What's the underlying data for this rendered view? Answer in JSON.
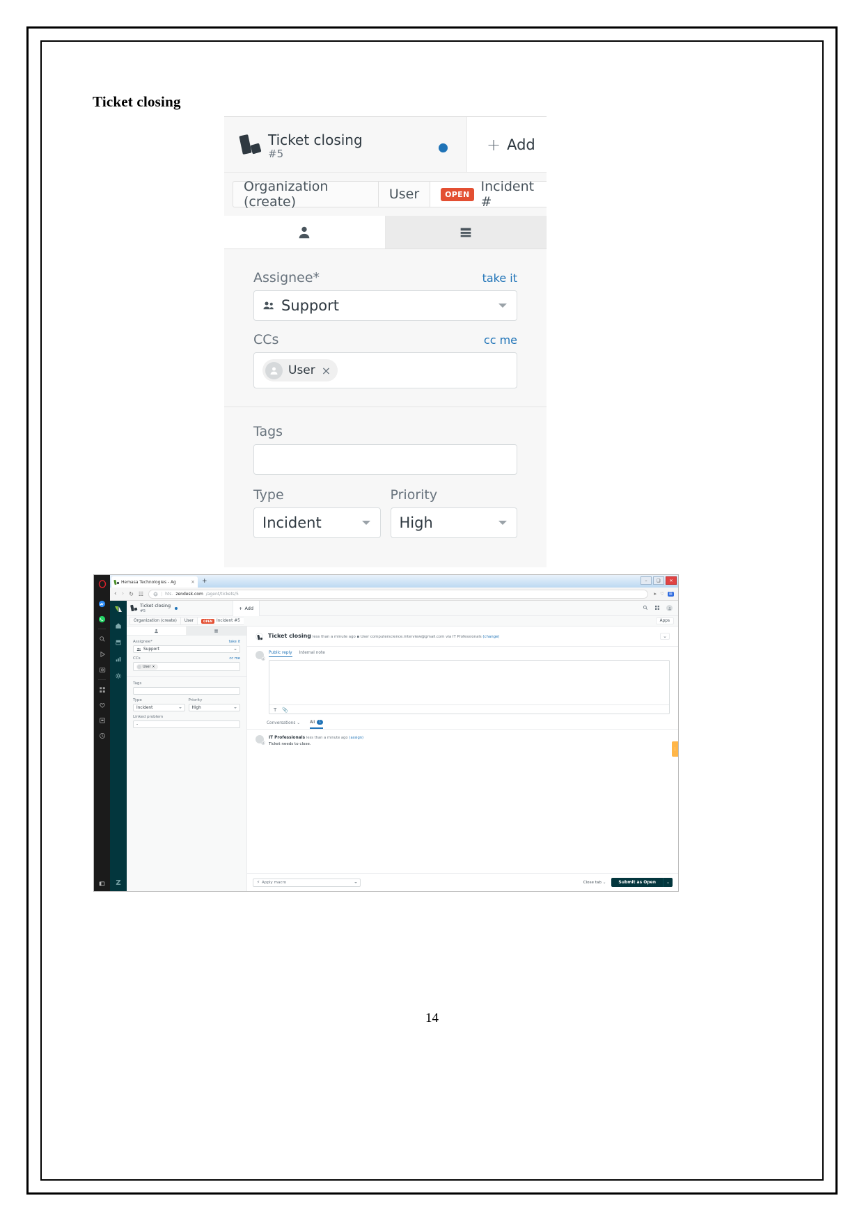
{
  "document": {
    "heading": "Ticket closing",
    "page_number": "14"
  },
  "zoom_panel": {
    "ticket_title": "Ticket closing",
    "ticket_number": "#5",
    "add_label": "Add",
    "add_plus": "+",
    "breadcrumbs": [
      {
        "label": "Organization (create)",
        "badge": ""
      },
      {
        "label": "User",
        "badge": ""
      },
      {
        "label": "Incident #",
        "badge": "OPEN"
      }
    ],
    "tabs": [
      {
        "icon": "person-icon",
        "selected": false
      },
      {
        "icon": "list-icon",
        "selected": true
      }
    ],
    "fields": {
      "assignee_label": "Assignee*",
      "assignee_action": "take it",
      "assignee_value": "Support",
      "ccs_label": "CCs",
      "ccs_action": "cc me",
      "ccs_chip": "User",
      "ccs_chip_remove": "×",
      "tags_label": "Tags",
      "tags_value": "",
      "type_label": "Type",
      "type_value": "Incident",
      "priority_label": "Priority",
      "priority_value": "High"
    }
  },
  "browser": {
    "tab_title": "Hemasa Technologies - Ag",
    "tab_close": "×",
    "new_tab": "+",
    "window_buttons": {
      "minimize": "–",
      "maximize": "❑",
      "close": "✕"
    },
    "nav": {
      "back": "‹",
      "forward": "›",
      "reload": "↻",
      "grid": "☷"
    },
    "omnibox": {
      "security_icon": "globe-icon",
      "url_prefix": "hts.",
      "url_domain": "zendesk.com",
      "url_path": "/agent/tickets/5"
    },
    "omni_right": {
      "share": "➤",
      "heart": "♡",
      "profile": "☰"
    },
    "opera_sidebar": [
      "opera-logo-icon",
      "messenger-icon",
      "whatsapp-icon",
      "search-icon",
      "player-icon",
      "snapshot-icon",
      "apps-grid-icon",
      "heart-icon",
      "notes-icon",
      "history-icon"
    ],
    "opera_bottom": "panel-toggle-icon"
  },
  "zendesk": {
    "nav_icons": [
      "zendesk-logo-icon",
      "home-icon",
      "views-icon",
      "reporting-icon",
      "admin-icon"
    ],
    "nav_footer": "Z",
    "header": {
      "ticket_title": "Ticket closing",
      "ticket_number": "#5",
      "add_label": "Add",
      "add_plus": "+",
      "search_icon": "search-icon",
      "apps_icon": "apps-grid-icon",
      "avatar_icon": "user-avatar-icon"
    },
    "breadcrumbs": [
      {
        "label": "Organization (create)",
        "badge": ""
      },
      {
        "label": "User",
        "badge": ""
      },
      {
        "label": "Incident #5",
        "badge": "OPEN"
      }
    ],
    "apps_button": "Apps",
    "left_panel": {
      "tabs": [
        {
          "icon": "person-icon",
          "selected": false
        },
        {
          "icon": "list-icon",
          "selected": true
        }
      ],
      "assignee_label": "Assignee*",
      "assignee_action": "take it",
      "assignee_value": "Support",
      "ccs_label": "CCs",
      "ccs_action": "cc me",
      "ccs_chip": "User",
      "ccs_chip_remove": "×",
      "tags_label": "Tags",
      "tags_value": "",
      "type_label": "Type",
      "type_value": "Incident",
      "priority_label": "Priority",
      "priority_value": "High",
      "linked_problem_label": "Linked problem",
      "linked_problem_value": "-"
    },
    "main": {
      "title": "Ticket closing",
      "meta_time": "less than a minute ago",
      "meta_sep": "▪",
      "meta_role": "User",
      "meta_email": "computerscience.interview@gmail.com via IT Professionals",
      "meta_change": "(change)",
      "collapse_icon": "chevron-down-icon",
      "compose_tabs": [
        {
          "label": "Public reply",
          "selected": true
        },
        {
          "label": "Internal note",
          "selected": false
        }
      ],
      "editor_placeholder": "",
      "editor_tools": [
        "text-format-icon",
        "attachment-icon"
      ],
      "conversations_label": "Conversations",
      "conversations_caret": "⌄",
      "all_label": "All",
      "all_count": "1",
      "comment": {
        "author": "IT Professionals",
        "time": "less than a minute ago",
        "action": "(assign)",
        "body": "Ticket needs to close."
      },
      "side_handle": "⋮"
    },
    "footer": {
      "macro_label": "Apply macro",
      "macro_icon": "bolt-icon",
      "close_tab_label": "Close tab",
      "close_tab_caret": "⌄",
      "submit_label": "Submit as Open",
      "submit_caret": "⌄"
    }
  }
}
